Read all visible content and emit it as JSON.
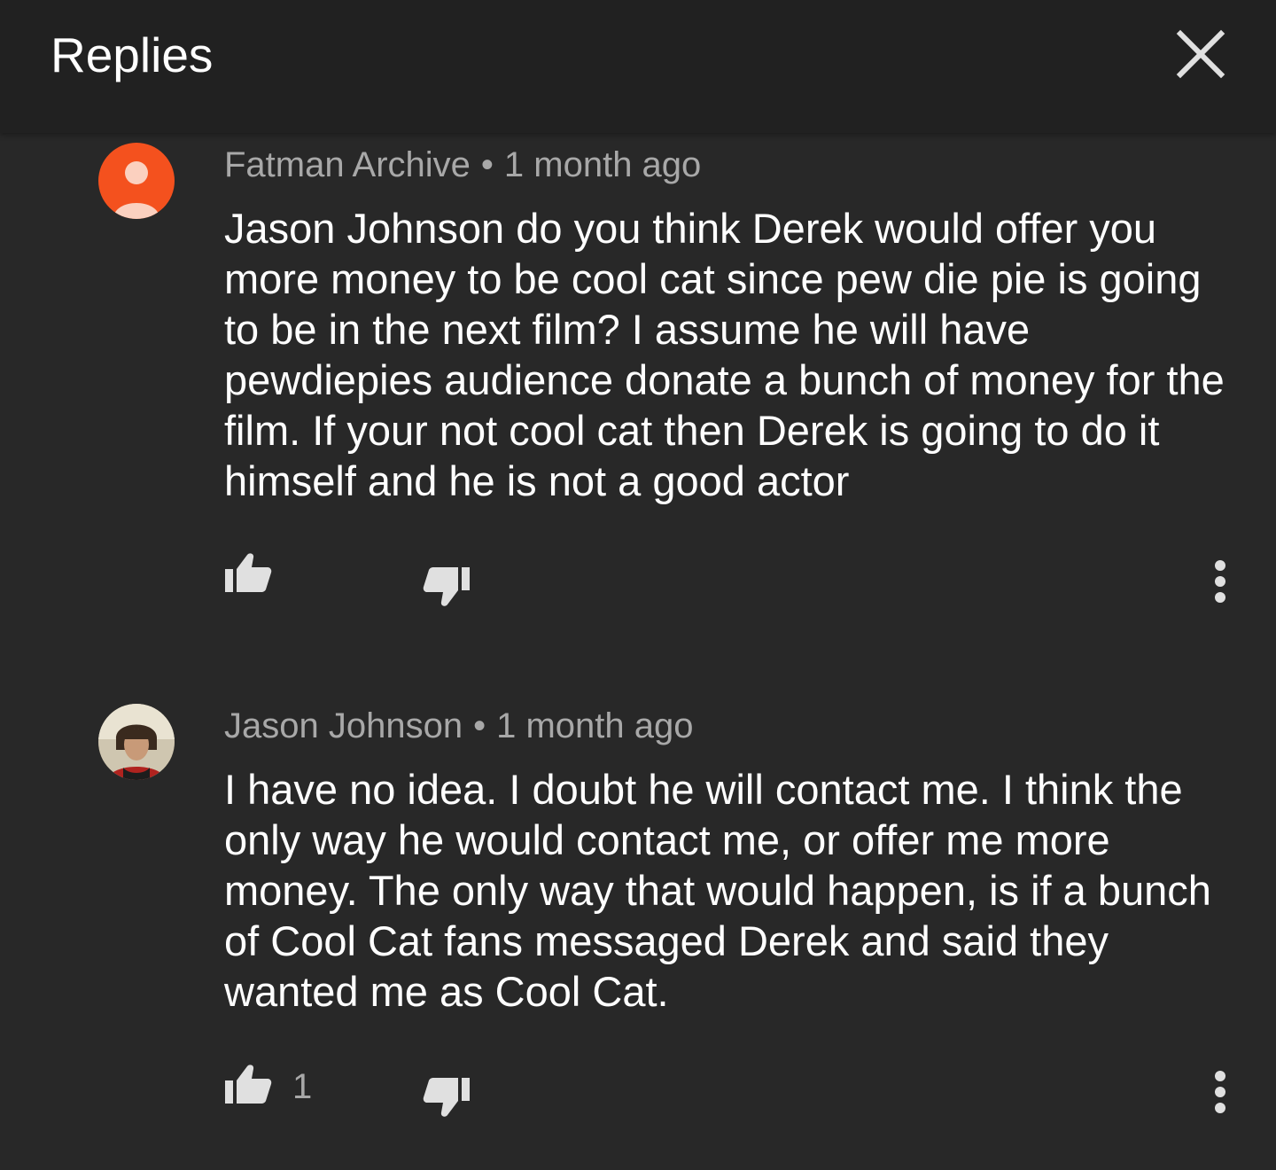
{
  "header": {
    "title": "Replies"
  },
  "comments": [
    {
      "author": "Fatman Archive",
      "separator": "•",
      "time": "1 month ago",
      "text": "Jason Johnson do you think Derek would offer you more money to be cool cat since pew die pie is going to be in the next film? I assume he will have pewdiepies audience donate a bunch of money for the film. If your not cool cat then Derek is going to do it himself and he is not a good actor",
      "like_count": "",
      "avatar_color": "#f4511e"
    },
    {
      "author": "Jason Johnson",
      "separator": "•",
      "time": "1 month ago",
      "text": "I have no idea. I doubt he will contact me. I think the only way he would contact me, or offer me more money. The only way that would happen, is if a bunch of Cool Cat fans messaged Derek and said they wanted me as Cool Cat.",
      "like_count": "1"
    }
  ],
  "icons": {
    "close": "close-icon",
    "like": "thumbs-up-icon",
    "dislike": "thumbs-down-icon",
    "menu": "more-vert-icon"
  },
  "colors": {
    "background": "#282828",
    "header": "#212121",
    "text_primary": "#ffffff",
    "text_secondary": "#a8a8a8",
    "icon": "#e0e0e0"
  }
}
